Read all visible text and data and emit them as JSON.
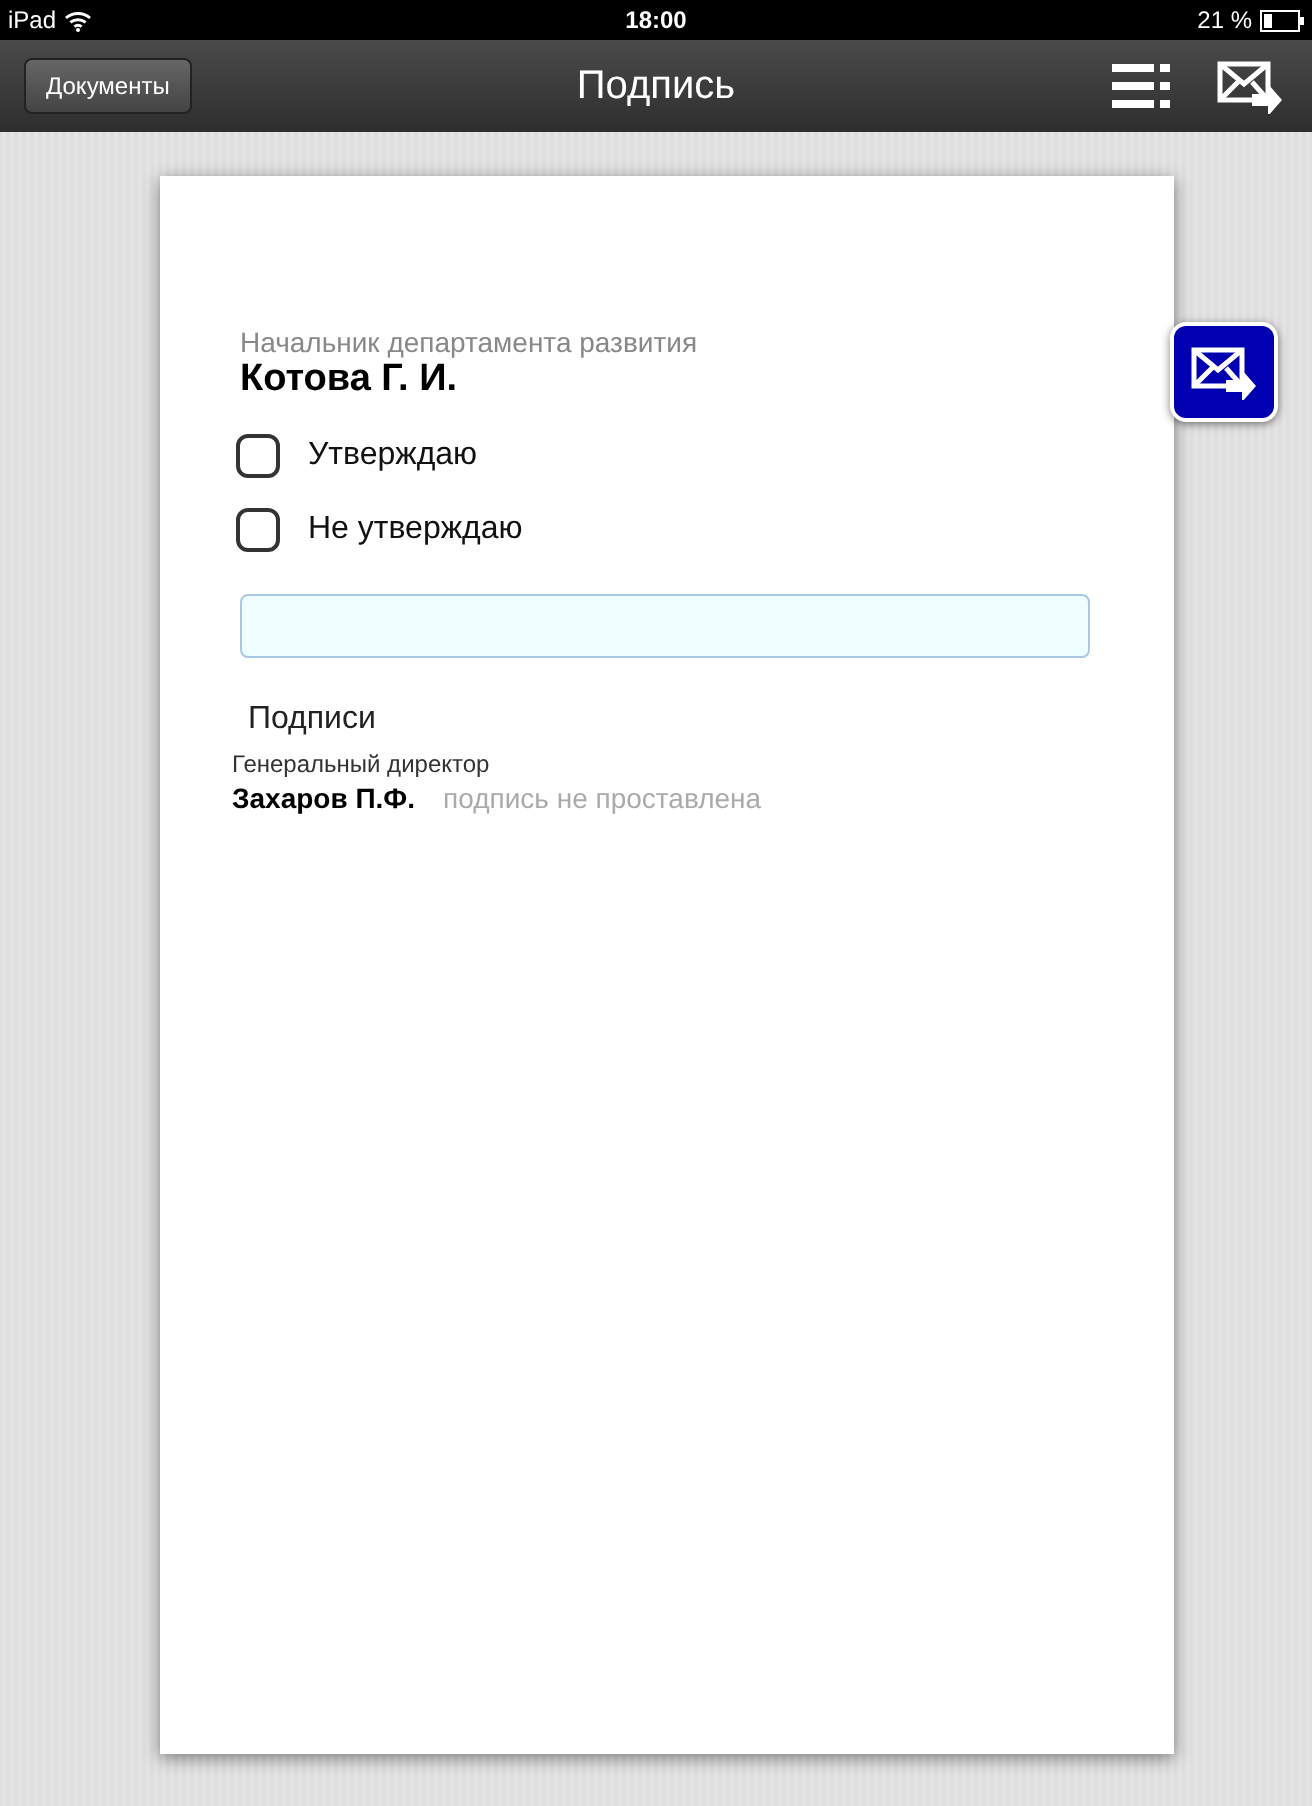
{
  "status_bar": {
    "device": "iPad",
    "time": "18:00",
    "battery": "21 %"
  },
  "nav_bar": {
    "back": "Документы",
    "title": "Подпись"
  },
  "document": {
    "position": "Начальник департамента развития",
    "name": "Котова Г. И.",
    "options": [
      {
        "label": "Утверждаю",
        "checked": false
      },
      {
        "label": "Не утверждаю",
        "checked": false
      }
    ],
    "signatures_heading": "Подписи",
    "signatures": [
      {
        "position": "Генеральный директор",
        "name": "Захаров П.Ф.",
        "status": "подпись не проставлена"
      }
    ]
  }
}
